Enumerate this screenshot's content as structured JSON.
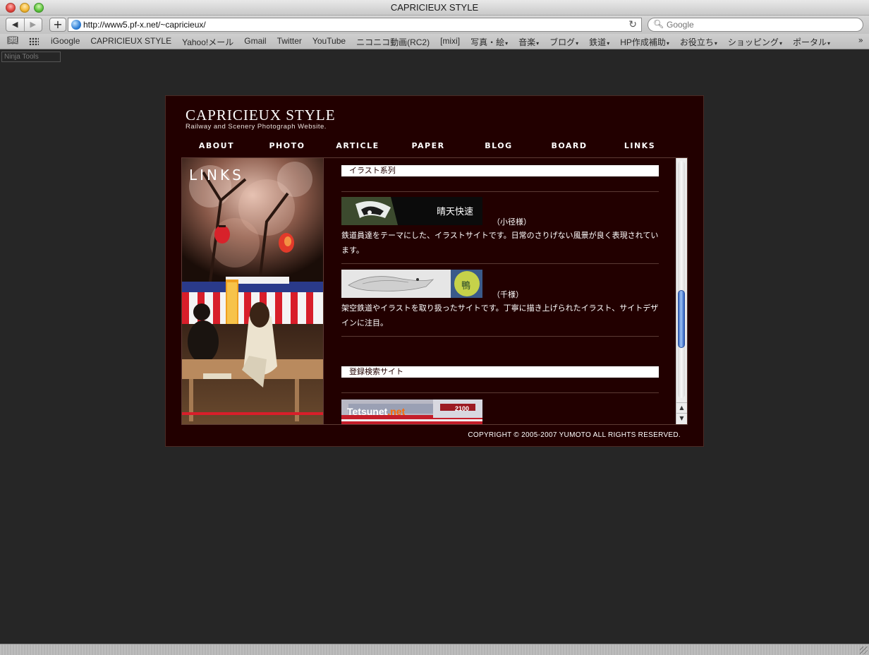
{
  "window": {
    "title": "CAPRICIEUX STYLE"
  },
  "toolbar": {
    "back_icon": "back-arrow",
    "forward_icon": "forward-arrow",
    "add_label": "+",
    "url": "http://www5.pf-x.net/~capricieux/",
    "search_placeholder": "Google"
  },
  "bookmarks": [
    {
      "label": "iGoogle",
      "arrow": ""
    },
    {
      "label": "CAPRICIEUX STYLE",
      "arrow": ""
    },
    {
      "label": "Yahoo!メール",
      "arrow": ""
    },
    {
      "label": "Gmail",
      "arrow": ""
    },
    {
      "label": "Twitter",
      "arrow": ""
    },
    {
      "label": "YouTube",
      "arrow": ""
    },
    {
      "label": "ニコニコ動画(RC2)",
      "arrow": ""
    },
    {
      "label": "[mixi]",
      "arrow": ""
    },
    {
      "label": "写真・絵",
      "arrow": "▾"
    },
    {
      "label": "音楽",
      "arrow": "▾"
    },
    {
      "label": "ブログ",
      "arrow": "▾"
    },
    {
      "label": "鉄道",
      "arrow": "▾"
    },
    {
      "label": "HP作成補助",
      "arrow": "▾"
    },
    {
      "label": "お役立ち",
      "arrow": "▾"
    },
    {
      "label": "ショッピング",
      "arrow": "▾"
    },
    {
      "label": "ポータル",
      "arrow": "▾"
    }
  ],
  "bookmarks_more": "»",
  "ninja_tools": "Ninja Tools",
  "site": {
    "title": "CAPRICIEUX STYLE",
    "subtitle": "Railway and Scenery Photograph Website.",
    "nav": [
      "ABOUT",
      "PHOTO",
      "ARTICLE",
      "PAPER",
      "BLOG",
      "BOARD",
      "LINKS"
    ],
    "page_label": "LINKS",
    "copyright": "COPYRIGHT © 2005-2007 YUMOTO ALL RIGHTS RESERVED."
  },
  "links": {
    "section1": "イラスト系列",
    "entries": [
      {
        "banner_text": "晴天快速",
        "owner": "（小径様）",
        "description": "鉄道員達をテーマにした、イラストサイトです。日常のさりげない風景が良く表現されています。"
      },
      {
        "banner_text": "鴨",
        "owner": "（千様）",
        "description": "架空鉄道やイラストを取り扱ったサイトです。丁寧に描き上げられたイラスト、サイトデザインに注目。"
      }
    ],
    "section2": "登録検索サイト",
    "banner3_text": "Tetsunet",
    "banner3_suffix": ".net",
    "banner3_number": "2100"
  },
  "scrollbar": {
    "position_fraction": 0.72
  },
  "colors": {
    "page_bg": "#220000",
    "accent": "#ffffff",
    "desktop": "#262626"
  }
}
